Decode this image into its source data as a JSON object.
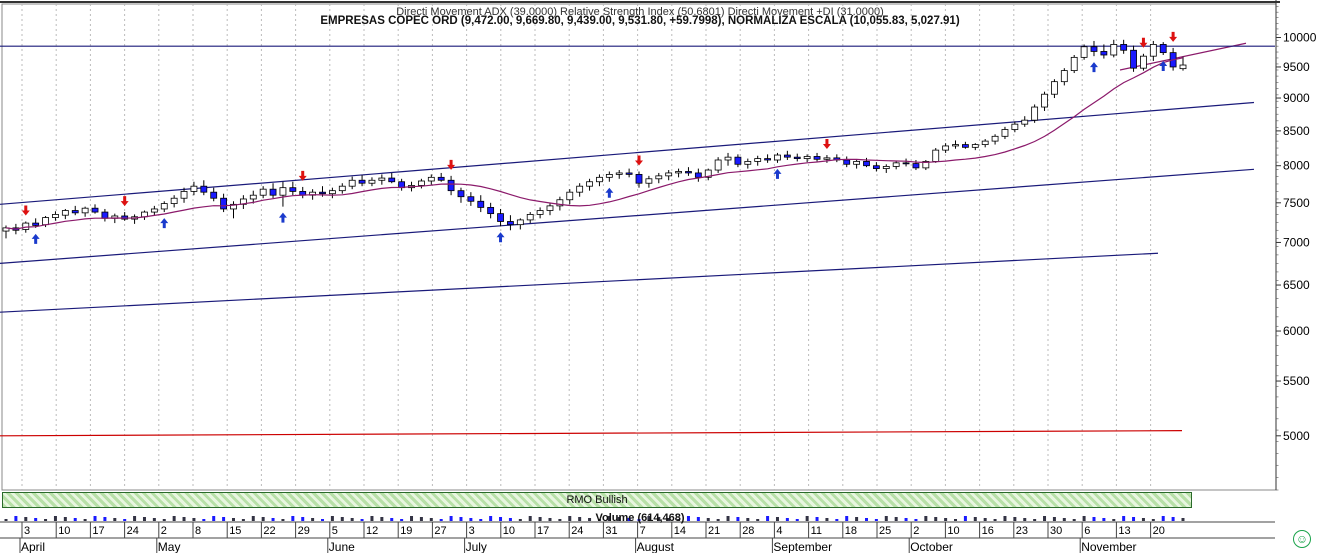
{
  "header": {
    "indicator_line": "Directi Movement ADX (39.0000) Relative Strength Index (50.6801) Directi Movement +DI (31.0000)",
    "title": "EMPRESAS COPEC ORD (9,472.00, 9,669.80, 9,439.00, 9,531.80, +59.7998), NORMALIZA ESCALA (10,055.83, 5,027.91)"
  },
  "rmo_label": "RMO Bullish",
  "volume_label": "Volume (614,468)",
  "icons": {
    "status": "smiley-icon"
  },
  "colors": {
    "up": "#ffffff",
    "down": "#1a1aff",
    "sma": "#8b1a6b",
    "trend": "#1a1a7a",
    "red": "#cc0000",
    "buy_arrow": "#1a3acc",
    "sell_arrow": "#dd1111"
  },
  "chart_data": {
    "type": "candlestick",
    "y_scale": "log",
    "ylim": [
      4550,
      10600
    ],
    "y_ticks": [
      10000,
      9500,
      9000,
      8500,
      8000,
      7500,
      7000,
      6500,
      6000,
      5500,
      5000
    ],
    "y_tick_labels": [
      "10000",
      "9500",
      "9000",
      "8500",
      "8000",
      "7500",
      "7000",
      "6500",
      "6000",
      "5500",
      "5000"
    ],
    "x_ticks": [
      "3",
      "10",
      "17",
      "24",
      "2",
      "8",
      "15",
      "22",
      "29",
      "5",
      "12",
      "19",
      "27",
      "3",
      "10",
      "17",
      "24",
      "31",
      "7",
      "14",
      "21",
      "28",
      "4",
      "11",
      "18",
      "25",
      "2",
      "10",
      "16",
      "23",
      "30",
      "6",
      "13",
      "20"
    ],
    "months": [
      {
        "label": "April",
        "tick": 0
      },
      {
        "label": "May",
        "tick": 4
      },
      {
        "label": "June",
        "tick": 9
      },
      {
        "label": "July",
        "tick": 13
      },
      {
        "label": "August",
        "tick": 18
      },
      {
        "label": "September",
        "tick": 22
      },
      {
        "label": "October",
        "tick": 26
      },
      {
        "label": "November",
        "tick": 31
      }
    ],
    "candles": [
      [
        7140,
        7210,
        7050,
        7180
      ],
      [
        7180,
        7230,
        7100,
        7150
      ],
      [
        7160,
        7260,
        7120,
        7240
      ],
      [
        7240,
        7300,
        7180,
        7210
      ],
      [
        7220,
        7330,
        7190,
        7310
      ],
      [
        7310,
        7390,
        7270,
        7350
      ],
      [
        7340,
        7420,
        7290,
        7400
      ],
      [
        7400,
        7460,
        7340,
        7370
      ],
      [
        7370,
        7450,
        7320,
        7430
      ],
      [
        7430,
        7480,
        7360,
        7380
      ],
      [
        7380,
        7420,
        7260,
        7300
      ],
      [
        7300,
        7360,
        7240,
        7330
      ],
      [
        7330,
        7380,
        7270,
        7290
      ],
      [
        7290,
        7350,
        7230,
        7320
      ],
      [
        7320,
        7400,
        7280,
        7380
      ],
      [
        7380,
        7460,
        7330,
        7420
      ],
      [
        7420,
        7520,
        7380,
        7490
      ],
      [
        7490,
        7600,
        7440,
        7560
      ],
      [
        7560,
        7700,
        7500,
        7650
      ],
      [
        7650,
        7780,
        7600,
        7720
      ],
      [
        7720,
        7800,
        7600,
        7640
      ],
      [
        7640,
        7700,
        7520,
        7560
      ],
      [
        7560,
        7620,
        7380,
        7420
      ],
      [
        7420,
        7520,
        7300,
        7480
      ],
      [
        7480,
        7600,
        7420,
        7550
      ],
      [
        7550,
        7660,
        7490,
        7600
      ],
      [
        7600,
        7720,
        7560,
        7680
      ],
      [
        7680,
        7760,
        7560,
        7600
      ],
      [
        7600,
        7780,
        7450,
        7700
      ],
      [
        7700,
        7780,
        7600,
        7650
      ],
      [
        7650,
        7710,
        7560,
        7600
      ],
      [
        7600,
        7680,
        7540,
        7640
      ],
      [
        7640,
        7720,
        7580,
        7620
      ],
      [
        7620,
        7700,
        7560,
        7660
      ],
      [
        7660,
        7760,
        7620,
        7720
      ],
      [
        7720,
        7850,
        7680,
        7800
      ],
      [
        7800,
        7870,
        7720,
        7760
      ],
      [
        7760,
        7840,
        7720,
        7800
      ],
      [
        7800,
        7880,
        7740,
        7830
      ],
      [
        7830,
        7900,
        7760,
        7780
      ],
      [
        7780,
        7820,
        7660,
        7700
      ],
      [
        7700,
        7780,
        7650,
        7730
      ],
      [
        7730,
        7820,
        7690,
        7790
      ],
      [
        7790,
        7880,
        7740,
        7840
      ],
      [
        7840,
        7900,
        7780,
        7800
      ],
      [
        7800,
        7860,
        7600,
        7660
      ],
      [
        7660,
        7700,
        7500,
        7580
      ],
      [
        7580,
        7640,
        7460,
        7520
      ],
      [
        7520,
        7600,
        7380,
        7440
      ],
      [
        7440,
        7500,
        7300,
        7360
      ],
      [
        7360,
        7420,
        7200,
        7260
      ],
      [
        7260,
        7340,
        7150,
        7220
      ],
      [
        7220,
        7300,
        7160,
        7280
      ],
      [
        7280,
        7380,
        7240,
        7350
      ],
      [
        7350,
        7440,
        7300,
        7400
      ],
      [
        7400,
        7500,
        7340,
        7460
      ],
      [
        7460,
        7580,
        7400,
        7540
      ],
      [
        7540,
        7680,
        7480,
        7640
      ],
      [
        7640,
        7760,
        7580,
        7720
      ],
      [
        7720,
        7820,
        7660,
        7780
      ],
      [
        7780,
        7880,
        7720,
        7840
      ],
      [
        7840,
        7920,
        7780,
        7880
      ],
      [
        7880,
        7940,
        7820,
        7900
      ],
      [
        7900,
        7960,
        7840,
        7880
      ],
      [
        7880,
        7920,
        7700,
        7760
      ],
      [
        7760,
        7860,
        7700,
        7820
      ],
      [
        7820,
        7900,
        7760,
        7860
      ],
      [
        7860,
        7940,
        7800,
        7900
      ],
      [
        7900,
        7960,
        7840,
        7920
      ],
      [
        7920,
        7980,
        7860,
        7900
      ],
      [
        7900,
        7960,
        7780,
        7840
      ],
      [
        7840,
        7960,
        7800,
        7940
      ],
      [
        7940,
        8120,
        7900,
        8080
      ],
      [
        8080,
        8180,
        8000,
        8120
      ],
      [
        8120,
        8160,
        7980,
        8020
      ],
      [
        8020,
        8100,
        7960,
        8060
      ],
      [
        8060,
        8140,
        8000,
        8100
      ],
      [
        8100,
        8160,
        8040,
        8080
      ],
      [
        8080,
        8180,
        8040,
        8150
      ],
      [
        8150,
        8210,
        8080,
        8120
      ],
      [
        8120,
        8170,
        8060,
        8100
      ],
      [
        8100,
        8160,
        8050,
        8130
      ],
      [
        8130,
        8180,
        8060,
        8090
      ],
      [
        8090,
        8150,
        8040,
        8110
      ],
      [
        8110,
        8160,
        8050,
        8080
      ],
      [
        8080,
        8130,
        7980,
        8020
      ],
      [
        8020,
        8080,
        7960,
        8060
      ],
      [
        8060,
        8110,
        7980,
        8000
      ],
      [
        8000,
        8050,
        7920,
        7960
      ],
      [
        7960,
        8020,
        7900,
        7990
      ],
      [
        7990,
        8060,
        7950,
        8040
      ],
      [
        8040,
        8100,
        7990,
        8030
      ],
      [
        8030,
        8080,
        7940,
        7970
      ],
      [
        7970,
        8080,
        7940,
        8060
      ],
      [
        8060,
        8250,
        8040,
        8220
      ],
      [
        8220,
        8320,
        8180,
        8280
      ],
      [
        8280,
        8360,
        8240,
        8300
      ],
      [
        8300,
        8340,
        8240,
        8260
      ],
      [
        8260,
        8320,
        8220,
        8300
      ],
      [
        8300,
        8380,
        8260,
        8350
      ],
      [
        8350,
        8450,
        8300,
        8420
      ],
      [
        8420,
        8560,
        8380,
        8520
      ],
      [
        8520,
        8640,
        8480,
        8600
      ],
      [
        8600,
        8720,
        8560,
        8660
      ],
      [
        8660,
        8900,
        8620,
        8860
      ],
      [
        8860,
        9100,
        8800,
        9060
      ],
      [
        9060,
        9300,
        9000,
        9260
      ],
      [
        9260,
        9480,
        9200,
        9440
      ],
      [
        9440,
        9700,
        9400,
        9660
      ],
      [
        9660,
        9880,
        9620,
        9840
      ],
      [
        9840,
        9940,
        9680,
        9760
      ],
      [
        9760,
        9880,
        9640,
        9700
      ],
      [
        9700,
        9960,
        9660,
        9880
      ],
      [
        9880,
        9960,
        9720,
        9780
      ],
      [
        9780,
        9860,
        9420,
        9480
      ],
      [
        9480,
        9720,
        9440,
        9680
      ],
      [
        9680,
        9940,
        9600,
        9880
      ],
      [
        9880,
        9920,
        9700,
        9740
      ],
      [
        9740,
        9820,
        9440,
        9500
      ],
      [
        9472,
        9670,
        9439,
        9532
      ]
    ],
    "sma_window": 14,
    "channel_lines": [
      {
        "color": "#1a1a7a",
        "points": [
          [
            0,
            7480
          ],
          [
            1254,
            8930
          ]
        ]
      },
      {
        "color": "#1a1a7a",
        "points": [
          [
            0,
            6750
          ],
          [
            1254,
            7950
          ]
        ]
      },
      {
        "color": "#1a1a7a",
        "points": [
          [
            0,
            6200
          ],
          [
            1158,
            6870
          ]
        ]
      },
      {
        "color": "#8b1a6b",
        "points": [
          [
            1120,
            9450
          ],
          [
            1246,
            9900
          ]
        ]
      },
      {
        "color": "#1a1a7a",
        "points": [
          [
            0,
            9850
          ],
          [
            1275,
            9850
          ]
        ]
      },
      {
        "color": "#cc0000",
        "points": [
          [
            0,
            5000
          ],
          [
            1182,
            5045
          ]
        ]
      }
    ],
    "buy_signals": [
      3,
      16,
      28,
      50,
      61,
      78,
      110,
      117
    ],
    "sell_signals": [
      2,
      12,
      30,
      45,
      64,
      83,
      115,
      118
    ]
  }
}
